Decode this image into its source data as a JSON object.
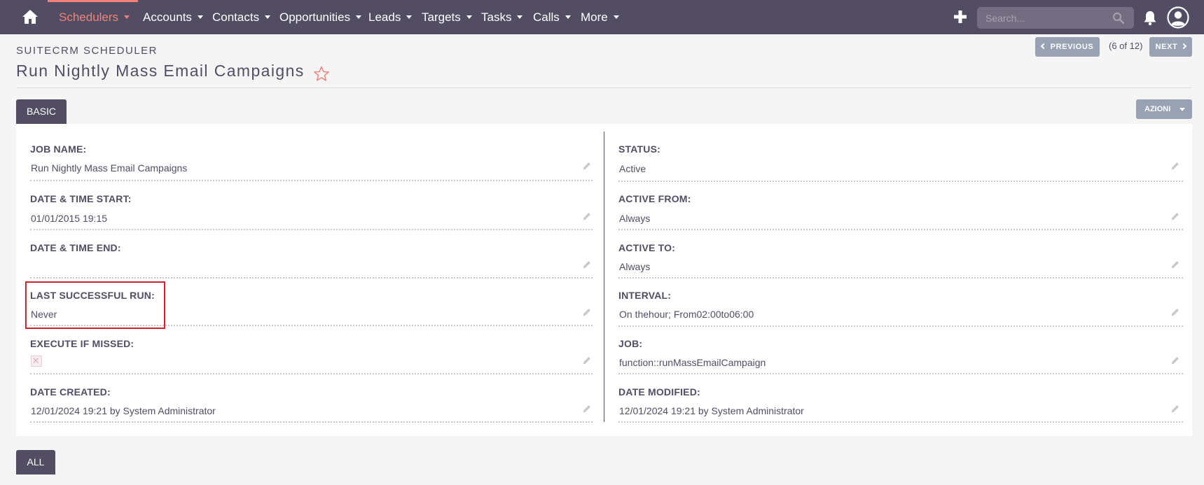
{
  "nav": {
    "items": [
      {
        "label": "Schedulers",
        "active": true
      },
      {
        "label": "Accounts",
        "active": false
      },
      {
        "label": "Contacts",
        "active": false
      },
      {
        "label": "Opportunities",
        "active": false
      },
      {
        "label": "Leads",
        "active": false
      },
      {
        "label": "Targets",
        "active": false
      },
      {
        "label": "Tasks",
        "active": false
      },
      {
        "label": "Calls",
        "active": false
      },
      {
        "label": "More",
        "active": false
      }
    ],
    "search_placeholder": "Search...",
    "icons": [
      "home-icon",
      "plus-icon",
      "search-icon",
      "bell-icon",
      "user-icon"
    ]
  },
  "header": {
    "module": "SUITECRM SCHEDULER",
    "title": "Run Nightly Mass Email Campaigns",
    "pager": {
      "previous": "PREVIOUS",
      "count": "(6 of 12)",
      "next": "NEXT"
    }
  },
  "tabs": {
    "basic": "BASIC",
    "all": "ALL",
    "actions": "AZIONI"
  },
  "fields": {
    "left": [
      {
        "label": "JOB NAME:",
        "value": "Run Nightly Mass Email Campaigns"
      },
      {
        "label": "DATE & TIME START:",
        "value": "01/01/2015 19:15"
      },
      {
        "label": "DATE & TIME END:",
        "value": ""
      },
      {
        "label": "LAST SUCCESSFUL RUN:",
        "value": "Never"
      },
      {
        "label": "EXECUTE IF MISSED:",
        "value": ""
      },
      {
        "label": "DATE CREATED:",
        "value": "12/01/2024 19:21 by System Administrator"
      }
    ],
    "right": [
      {
        "label": "STATUS:",
        "value": "Active"
      },
      {
        "label": "ACTIVE FROM:",
        "value": "Always"
      },
      {
        "label": "ACTIVE TO:",
        "value": "Always"
      },
      {
        "label": "INTERVAL:",
        "value": "On thehour; From02:00to06:00"
      },
      {
        "label": "JOB:",
        "value": "function::runMassEmailCampaign"
      },
      {
        "label": "DATE MODIFIED:",
        "value": "12/01/2024 19:21 by System Administrator"
      }
    ]
  },
  "execute_if_missed_checked": false,
  "colors": {
    "navbar": "#534d64",
    "accent": "#f08377",
    "button": "#99a2b2",
    "highlight": "#d2232a"
  }
}
